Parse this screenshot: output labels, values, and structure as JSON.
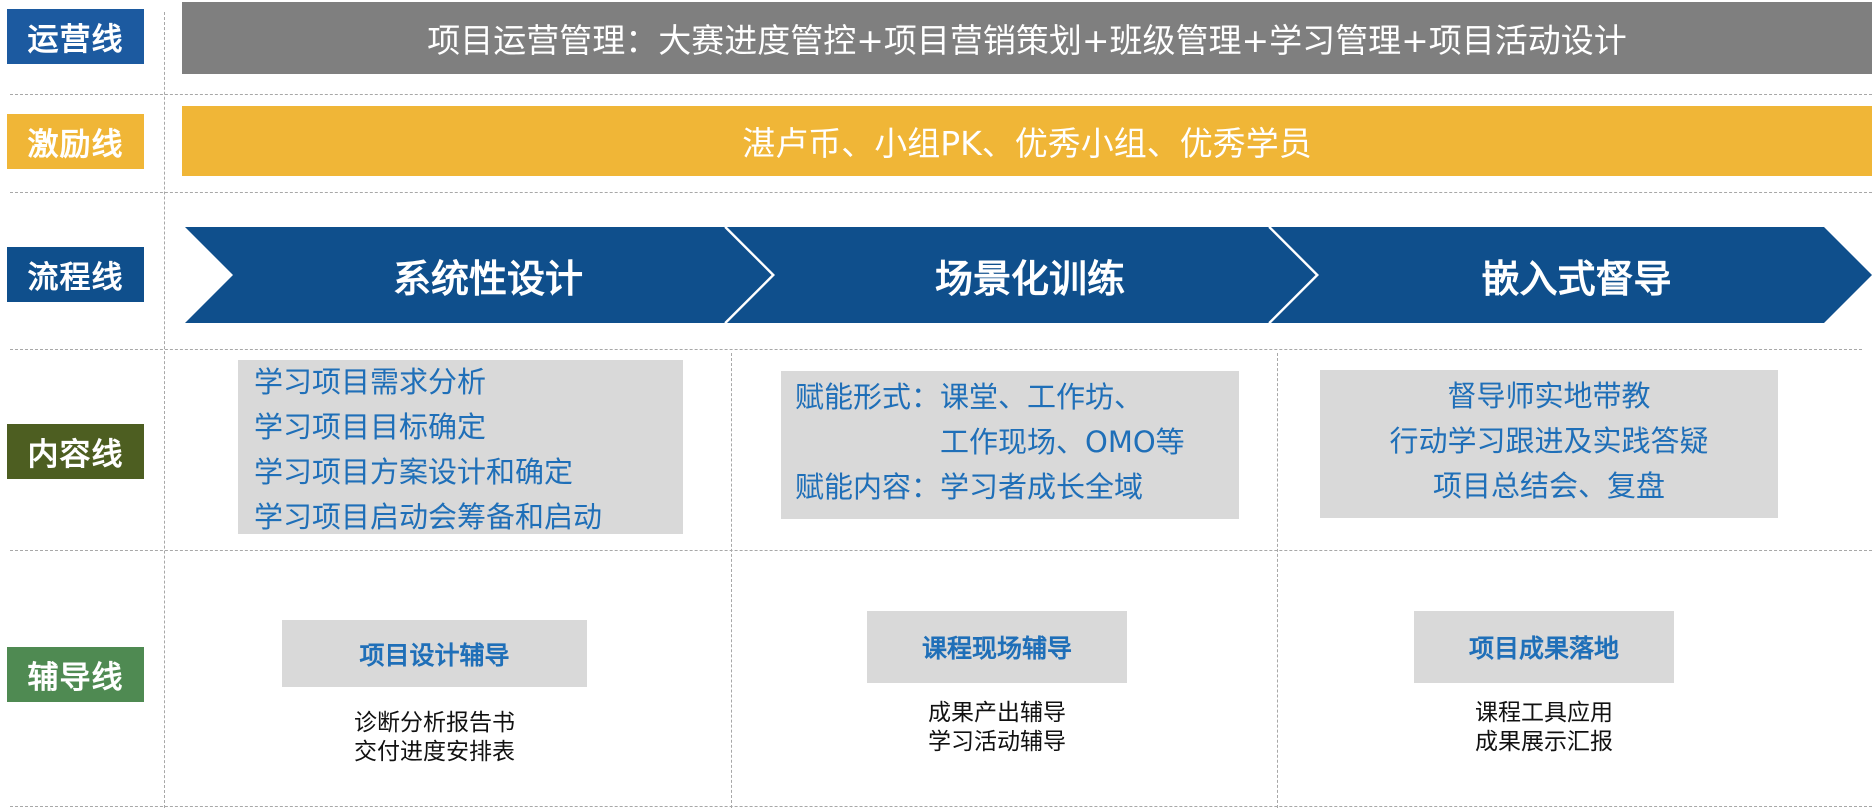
{
  "colors": {
    "operation": "#1c5aa0",
    "incentive": "#f0b637",
    "process": "#0f4f8c",
    "content": "#4d5e21",
    "coaching": "#4f8a52",
    "banner_gray": "#7f7f7f",
    "box_gray": "#d9d9d9",
    "text_blue": "#1f6fb8"
  },
  "lanes": {
    "operation": {
      "label": "运营线",
      "text": "项目运营管理：大赛进度管控+项目营销策划+班级管理+学习管理+项目活动设计"
    },
    "incentive": {
      "label": "激励线",
      "text": "湛卢币、小组PK、优秀小组、优秀学员"
    },
    "process": {
      "label": "流程线",
      "stages": [
        "系统性设计",
        "场景化训练",
        "嵌入式督导"
      ]
    },
    "content": {
      "label": "内容线",
      "col1": [
        "学习项目需求分析",
        "学习项目目标确定",
        "学习项目方案设计和确定",
        "学习项目启动会筹备和启动"
      ],
      "col2": {
        "prefix1": "赋能形式：",
        "line1": "课堂、工作坊、",
        "line2": "工作现场、OMO等",
        "prefix2": "赋能内容：",
        "line3": "学习者成长全域"
      },
      "col3": [
        "督导师实地带教",
        "行动学习跟进及实践答疑",
        "项目总结会、复盘"
      ]
    },
    "coaching": {
      "label": "辅导线",
      "cols": [
        {
          "title": "项目设计辅导",
          "items": [
            "诊断分析报告书",
            "交付进度安排表"
          ]
        },
        {
          "title": "课程现场辅导",
          "items": [
            "成果产出辅导",
            "学习活动辅导"
          ]
        },
        {
          "title": "项目成果落地",
          "items": [
            "课程工具应用",
            "成果展示汇报"
          ]
        }
      ]
    }
  }
}
